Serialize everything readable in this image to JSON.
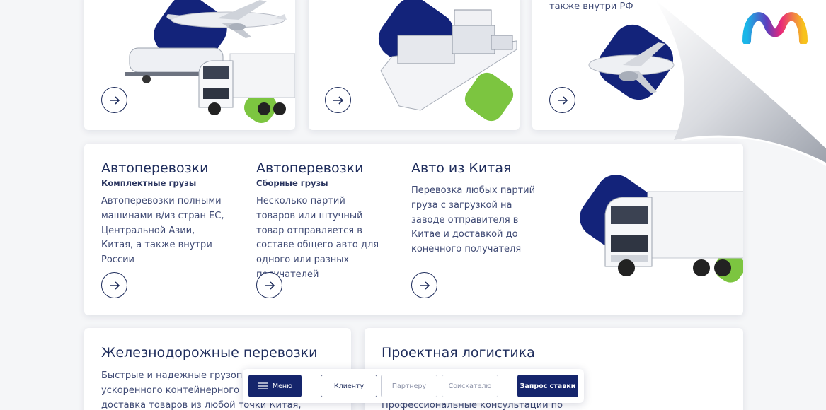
{
  "top_cards": [
    {
      "name": "air-auto",
      "text": ""
    },
    {
      "name": "sea",
      "text": ""
    },
    {
      "name": "air",
      "text": "также внутри РФ"
    }
  ],
  "middle_card": {
    "columns": [
      {
        "title": "Автоперевозки",
        "subtitle": "Комплектные грузы",
        "description": "Автоперевозки полными машинами в/из стран ЕС, Центральной Азии, Китая, а также внутри России"
      },
      {
        "title": "Автоперевозки",
        "subtitle": "Сборные грузы",
        "description": "Несколько партий товаров или штучный товар отправляется в составе общего авто для одного или разных получателей"
      },
      {
        "title": "Авто из Китая",
        "subtitle": "",
        "description": "Перевозка любых партий груза с загрузкой на заводе отправителя в Китае и доставкой до конечного получателя"
      }
    ]
  },
  "bottom_cards": [
    {
      "title": "Железнодорожные перевозки",
      "description": "Быстрые и надежные грузоперевозки, ускоренного контейнерного поезда, доставка товаров из любой точки Китая, включая"
    },
    {
      "title": "Проектная логистика",
      "description": "Профессиональные консультации по"
    }
  ],
  "toolbar": {
    "menu_label": "Меню",
    "client_label": "Клиенту",
    "partner_label": "Партнеру",
    "applicant_label": "Соискателю",
    "request_label": "Запрос ставки"
  },
  "colors": {
    "brand_navy": "#13237a",
    "brand_green": "#7cc540",
    "text_navy": "#1f2d5c"
  },
  "icons": [
    "arrow-right-icon",
    "hamburger-icon",
    "logo-m-icon",
    "truck-icon",
    "airplane-icon",
    "ship-icon"
  ]
}
